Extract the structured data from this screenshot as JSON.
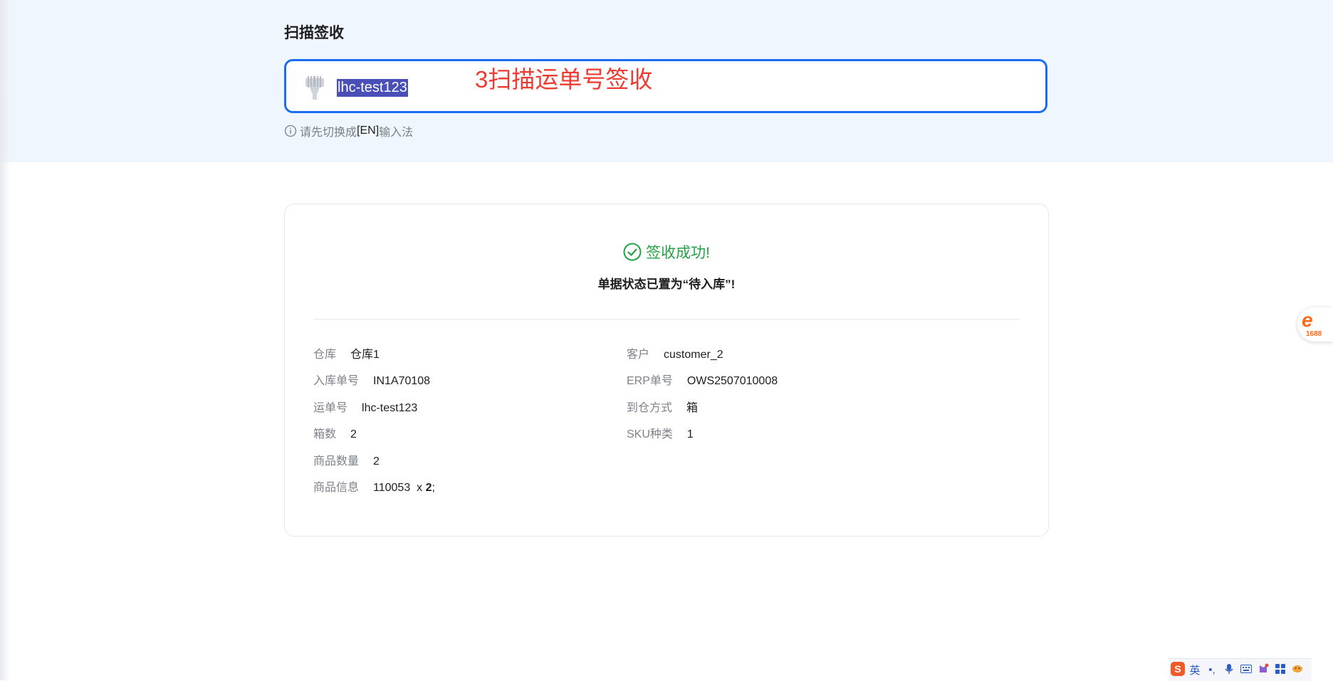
{
  "page": {
    "title": "扫描签收"
  },
  "scan": {
    "value": "lhc-test123",
    "annotation": "3扫描运单号签收",
    "hint_prefix": "请先切换成",
    "hint_en": "[EN]",
    "hint_suffix": "输入法"
  },
  "result": {
    "success": "签收成功!",
    "status": "单据状态已置为“待入库”!"
  },
  "details": {
    "warehouse": {
      "label": "仓库",
      "value": "仓库1"
    },
    "customer": {
      "label": "客户",
      "value": "customer_2"
    },
    "inbound_no": {
      "label": "入库单号",
      "value": "IN1A70108"
    },
    "erp_no": {
      "label": "ERP单号",
      "value": "OWS2507010008"
    },
    "waybill_no": {
      "label": "运单号",
      "value": "lhc-test123"
    },
    "arrival": {
      "label": "到仓方式",
      "value": "箱"
    },
    "boxes": {
      "label": "箱数",
      "value": "2"
    },
    "sku_types": {
      "label": "SKU种类",
      "value": "1"
    },
    "item_qty": {
      "label": "商品数量",
      "value": "2"
    },
    "item_info": {
      "label": "商品信息",
      "sku": "110053",
      "times": "x",
      "qty": "2",
      "sep": ";"
    }
  },
  "colors": {
    "accent": "#1b6ef3",
    "success": "#25a243",
    "annotation": "#ee3b32",
    "band": "#eff6fd"
  },
  "icons": {
    "scanner": "scanner-icon",
    "info": "info-icon",
    "success": "check-circle-icon"
  },
  "side_badge": {
    "brand": "1688"
  },
  "tray": {
    "ime_logo": "S",
    "lang": "英",
    "punct": "•,",
    "icons": [
      "microphone-icon",
      "keyboard-icon",
      "skin-icon",
      "toolbox-icon",
      "emoji-icon"
    ]
  }
}
